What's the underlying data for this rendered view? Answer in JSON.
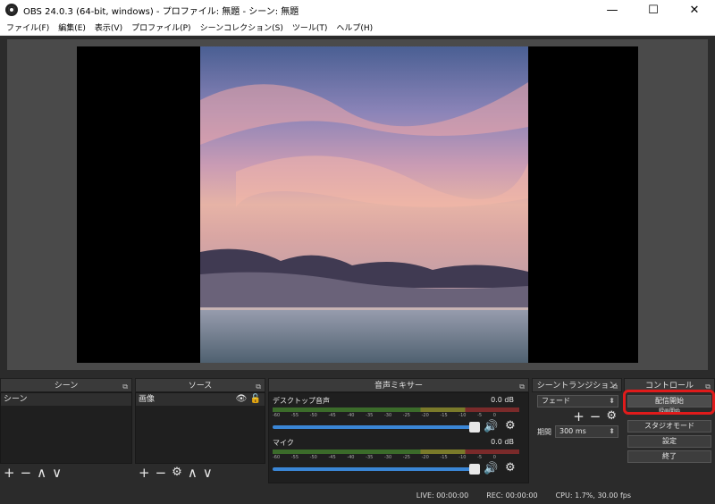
{
  "window": {
    "title": "OBS 24.0.3 (64-bit, windows) - プロファイル: 無題 - シーン: 無題",
    "minimize": "—",
    "maximize": "☐",
    "close": "✕"
  },
  "menu": [
    "ファイル(F)",
    "編集(E)",
    "表示(V)",
    "プロファイル(P)",
    "シーンコレクション(S)",
    "ツール(T)",
    "ヘルプ(H)"
  ],
  "scenes": {
    "header": "シーン",
    "items": [
      "シーン"
    ],
    "add": "+",
    "remove": "−",
    "up": "∧",
    "down": "∨"
  },
  "sources": {
    "header": "ソース",
    "items": [
      "画像"
    ],
    "add": "+",
    "remove": "−",
    "settings": "⚙",
    "up": "∧",
    "down": "∨"
  },
  "mixer": {
    "header": "音声ミキサー",
    "scale": [
      "-60",
      "-55",
      "-50",
      "-45",
      "-40",
      "-35",
      "-30",
      "-25",
      "-20",
      "-15",
      "-10",
      "-5",
      "0"
    ],
    "tracks": [
      {
        "name": "デスクトップ音声",
        "db": "0.0 dB",
        "volume": 1.0
      },
      {
        "name": "マイク",
        "db": "0.0 dB",
        "volume": 1.0
      }
    ]
  },
  "transitions": {
    "header": "シーントランジション",
    "selected": "フェード",
    "add": "+",
    "remove": "−",
    "duration_label": "期間",
    "duration_value": "300 ms"
  },
  "controls": {
    "header": "コントロール",
    "start_streaming": "配信開始",
    "start_recording": "録画開始",
    "studio_mode": "スタジオモード",
    "settings": "設定",
    "exit": "終了"
  },
  "status": {
    "live": "LIVE: 00:00:00",
    "rec": "REC: 00:00:00",
    "cpu": "CPU: 1.7%, 30.00 fps"
  },
  "colors": {
    "highlight": "#e01b1b",
    "fader": "#3a86d6"
  }
}
